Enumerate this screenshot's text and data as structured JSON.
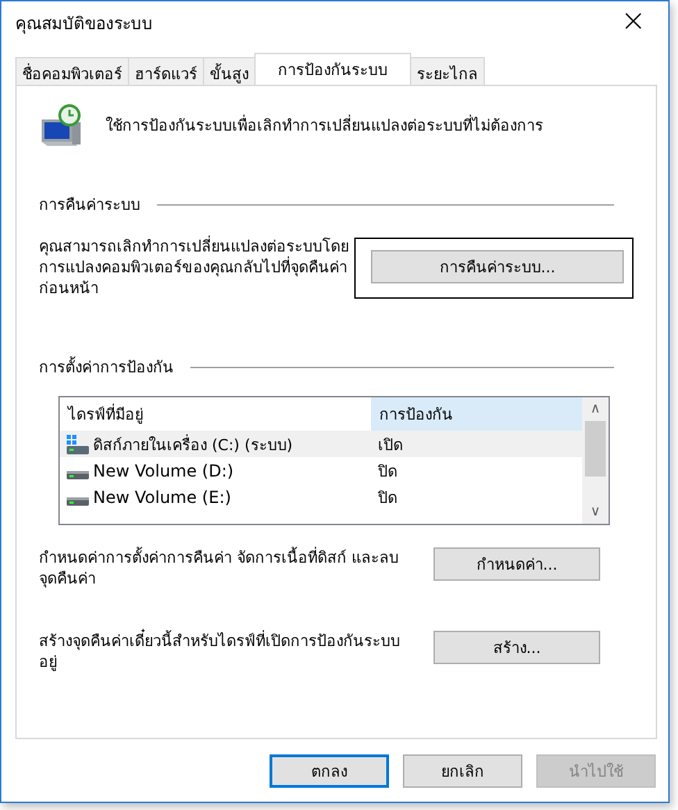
{
  "window": {
    "title": "คุณสมบัติของระบบ",
    "close": "×"
  },
  "tabs": [
    {
      "label": "ชื่อคอมพิวเตอร์",
      "selected": false
    },
    {
      "label": "ฮาร์ดแวร์",
      "selected": false
    },
    {
      "label": "ขั้นสูง",
      "selected": false
    },
    {
      "label": "การป้องกันระบบ",
      "selected": true
    },
    {
      "label": "ระยะไกล",
      "selected": false
    }
  ],
  "intro": "ใช้การป้องกันระบบเพื่อเลิกทำการเปลี่ยนแปลงต่อระบบที่ไม่ต้องการ",
  "restore": {
    "heading": "การคืนค่าระบบ",
    "text": "คุณสามารถเลิกทำการเปลี่ยนแปลงต่อระบบโดยการแปลงคอมพิวเตอร์ของคุณกลับไปที่จุดคืนค่าก่อนหน้า",
    "button": "การคืนค่าระบบ..."
  },
  "protection": {
    "heading": "การตั้งค่าการป้องกัน",
    "columns": [
      "ไดรฟ์ที่มีอยู่",
      "การป้องกัน"
    ],
    "rows": [
      {
        "kind": "system",
        "drive": "ดิสก์ภายในเครื่อง (C:) (ระบบ)",
        "status": "เปิด",
        "selected": true
      },
      {
        "kind": "volume",
        "drive": "New Volume (D:)",
        "status": "ปิด",
        "selected": false
      },
      {
        "kind": "volume",
        "drive": "New Volume (E:)",
        "status": "ปิด",
        "selected": false
      }
    ],
    "scroll_up": "∧",
    "scroll_down": "∨",
    "configure_text": "กำหนดค่าการตั้งค่าการคืนค่า จัดการเนื้อที่ดิสก์ และลบจุดคืนค่า",
    "configure_button": "กำหนดค่า...",
    "create_text": "สร้างจุดคืนค่าเดี๋ยวนี้สำหรับไดรฟ์ที่เปิดการป้องกันระบบอยู่",
    "create_button": "สร้าง..."
  },
  "buttons": [
    {
      "label": "ตกลง",
      "kind": "default",
      "disabled": false
    },
    {
      "label": "ยกเลิก",
      "kind": "normal",
      "disabled": false
    },
    {
      "label": "นำไปใช้",
      "kind": "normal",
      "disabled": true
    }
  ]
}
